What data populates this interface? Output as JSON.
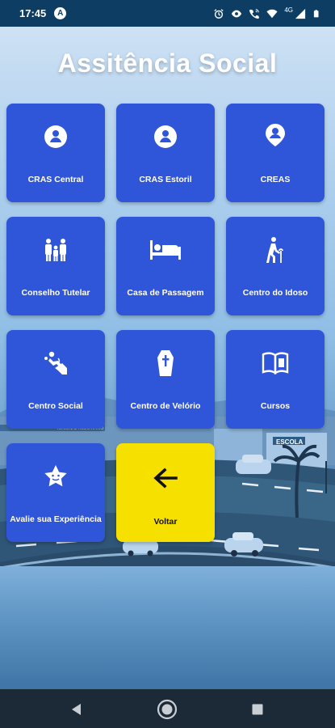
{
  "status_bar": {
    "time": "17:45",
    "network": "4G"
  },
  "page": {
    "title": "Assitência Social"
  },
  "tiles": [
    {
      "label": "CRAS Central",
      "icon": "person-circle-icon"
    },
    {
      "label": "CRAS Estoril",
      "icon": "person-circle-icon"
    },
    {
      "label": "CREAS",
      "icon": "person-pin-icon"
    },
    {
      "label": "Conselho Tutelar",
      "icon": "family-icon"
    },
    {
      "label": "Casa de Passagem",
      "icon": "bed-icon"
    },
    {
      "label": "Centro do Idoso",
      "icon": "elderly-icon"
    },
    {
      "label": "Centro Social",
      "icon": "social-hands-icon"
    },
    {
      "label": "Centro de Velório",
      "icon": "coffin-icon"
    },
    {
      "label": "Cursos",
      "icon": "book-icon"
    },
    {
      "label": "Avalie sua Experiência",
      "icon": "star-rating-icon"
    },
    {
      "label": "Voltar",
      "icon": "arrow-left-icon"
    }
  ],
  "colors": {
    "tile_blue": "#2f56d9",
    "tile_yellow": "#f6e000",
    "status_bar": "#0d3d63",
    "nav_bar": "#1c2a38"
  }
}
